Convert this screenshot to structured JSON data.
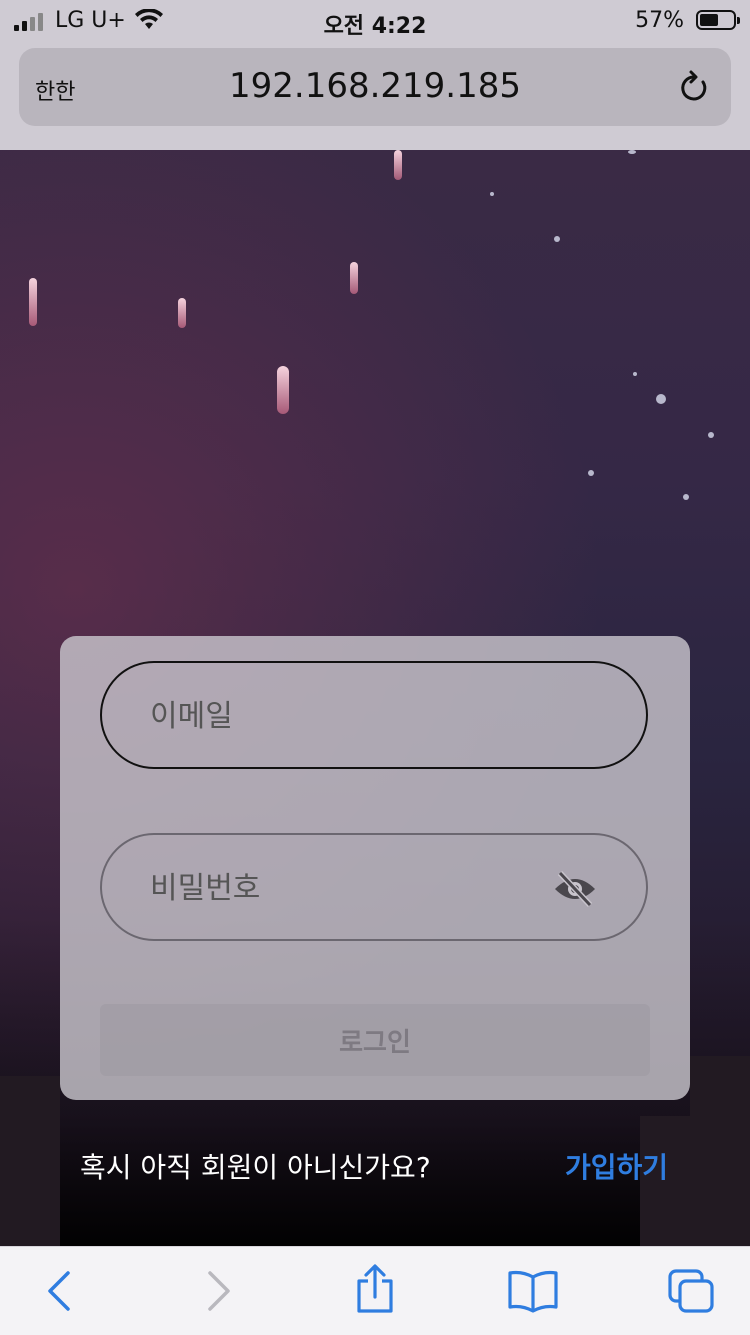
{
  "status_bar": {
    "carrier": "LG U+",
    "time": "오전 4:22",
    "battery": "57%",
    "battery_level": 0.57
  },
  "browser": {
    "aa_label": "한한",
    "url": "192.168.219.185"
  },
  "login": {
    "email_placeholder": "이메일",
    "password_placeholder": "비밀번호",
    "login_label": "로그인"
  },
  "signup": {
    "question": "혹시 아직 회원이 아니신가요?",
    "link": "가입하기"
  },
  "colors": {
    "accent": "#2f7de0",
    "toolbar_icon": "#2f7de0",
    "toolbar_disabled": "#b9b8be"
  },
  "toolbar": {
    "icons": [
      "back-icon",
      "forward-icon",
      "share-icon",
      "bookmarks-icon",
      "tabs-icon"
    ]
  }
}
